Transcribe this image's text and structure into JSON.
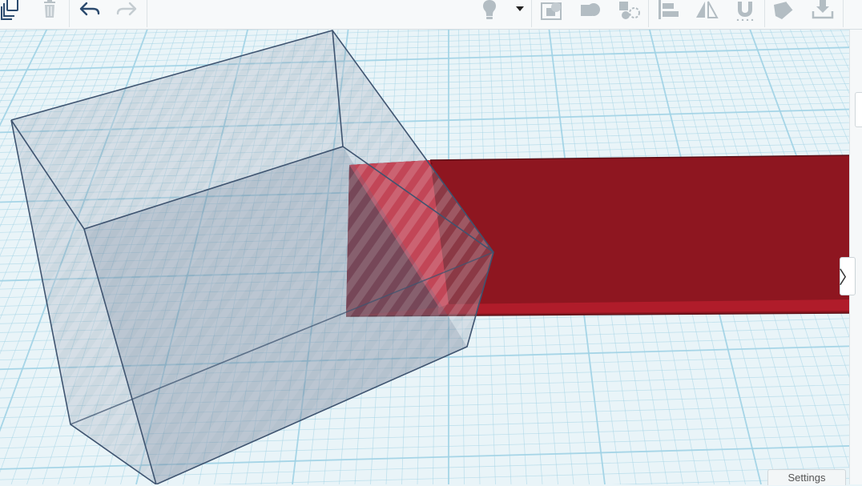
{
  "toolbar": {
    "left_tools": [
      {
        "name": "copy-icon",
        "enabled": true
      },
      {
        "name": "delete-icon",
        "enabled": false
      },
      {
        "name": "undo-icon",
        "enabled": true
      },
      {
        "name": "redo-icon",
        "enabled": false
      }
    ],
    "right_tools": [
      {
        "name": "light-bulb-icon"
      },
      {
        "name": "dropdown-arrow-icon"
      },
      {
        "name": "group-icon"
      },
      {
        "name": "ungroup-icon"
      },
      {
        "name": "hole-solid-icon"
      },
      {
        "name": "align-icon"
      },
      {
        "name": "mirror-icon"
      },
      {
        "name": "magnet-icon"
      },
      {
        "name": "paint-icon"
      },
      {
        "name": "import-icon"
      }
    ]
  },
  "workplane": {
    "grid_color": "#9fd1e4",
    "background_color": "#e9f4f8",
    "shapes": [
      {
        "name": "transparent-hole-box",
        "color": "#8a99ab"
      },
      {
        "name": "red-box",
        "color": "#8e1620"
      }
    ]
  },
  "panel_toggle": {
    "label": "〉"
  },
  "settings": {
    "label": "Settings"
  },
  "colors": {
    "toolbar_bg": "#f7f9fa",
    "icon": "#9aa6ad",
    "icon_active": "#2b4a6e",
    "red_solid": "#8e1620",
    "red_highlight": "#d92839"
  }
}
